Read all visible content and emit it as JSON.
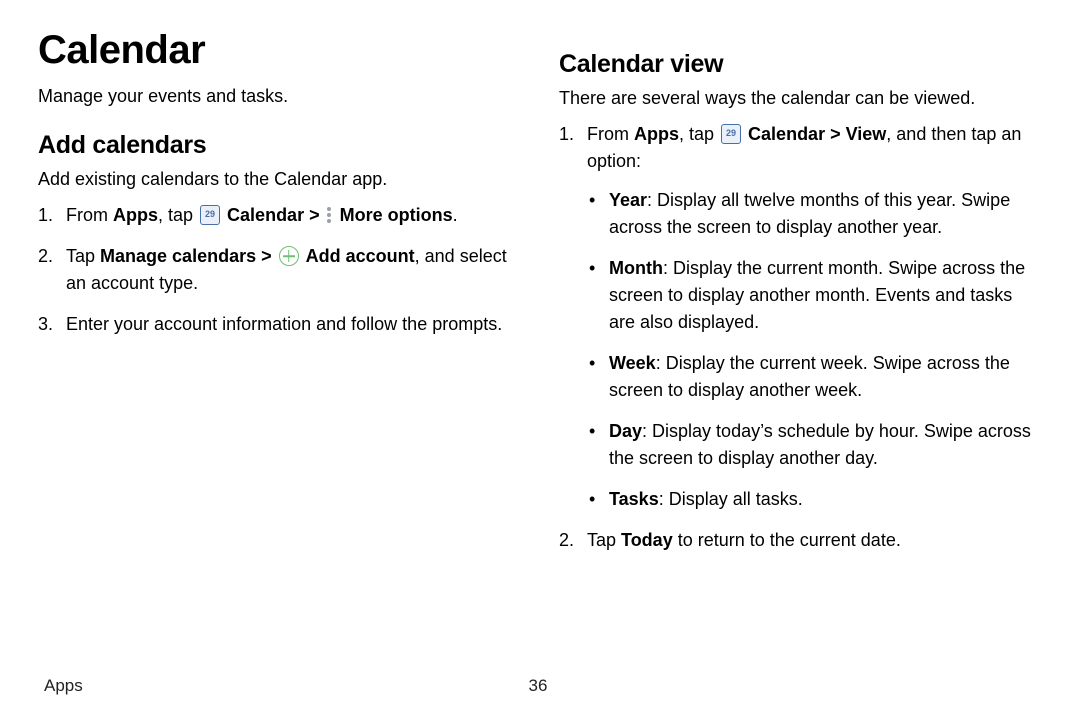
{
  "left": {
    "title": "Calendar",
    "intro": "Manage your events and tasks.",
    "section_title": "Add calendars",
    "section_desc": "Add existing calendars to the Calendar app.",
    "step1": {
      "pre": "From ",
      "apps": "Apps",
      "mid1": ", tap ",
      "calendar": "Calendar",
      "chevron": " > ",
      "more_options": "More options",
      "end": "."
    },
    "step2": {
      "pre": "Tap ",
      "manage": "Manage calendars",
      "chevron": " > ",
      "add_account": "Add account",
      "tail": ", and select an account type."
    },
    "step3": "Enter your account information and follow the prompts."
  },
  "right": {
    "title": "Calendar view",
    "intro": "There are several ways the calendar can be viewed.",
    "step1": {
      "pre": "From ",
      "apps": "Apps",
      "mid1": ", tap ",
      "calendar": "Calendar",
      "chevron": " > ",
      "view": "View",
      "tail": ", and then tap an option:"
    },
    "bullets": {
      "year_label": "Year",
      "year_text": ": Display all twelve months of this year. Swipe across the screen to display another year.",
      "month_label": "Month",
      "month_text": ": Display the current month. Swipe across the screen to display another month. Events and tasks are also displayed.",
      "week_label": "Week",
      "week_text": ": Display the current week. Swipe across the screen to display another week.",
      "day_label": "Day",
      "day_text": ": Display today’s schedule by hour. Swipe across the screen to display another day.",
      "tasks_label": "Tasks",
      "tasks_text": ": Display all tasks."
    },
    "step2": {
      "pre": "Tap ",
      "today": "Today",
      "tail": " to return to the current date."
    }
  },
  "footer": {
    "section": "Apps",
    "page": "36"
  }
}
